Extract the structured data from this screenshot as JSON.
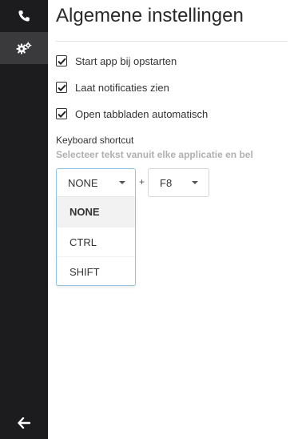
{
  "sidebar": {
    "items": [
      {
        "icon": "phone-icon"
      },
      {
        "icon": "gears-icon",
        "active": true
      },
      {
        "icon": "arrow-left-icon"
      }
    ]
  },
  "page": {
    "title": "Algemene instellingen"
  },
  "options": [
    {
      "label": "Start app bij opstarten",
      "checked": true
    },
    {
      "label": "Laat notificaties zien",
      "checked": true
    },
    {
      "label": "Open tabbladen automatisch",
      "checked": true
    }
  ],
  "shortcut": {
    "title": "Keyboard shortcut",
    "description": "Selecteer tekst vanuit elke applicatie en bel",
    "modifier_value": "NONE",
    "plus": "+",
    "key_value": "F8",
    "modifier_options": [
      "NONE",
      "CTRL",
      "SHIFT"
    ]
  },
  "colors": {
    "sidebar_bg": "#1c1c1e",
    "sidebar_active_bg": "#3a3a3d",
    "focus_border": "#8fc6e6",
    "muted_text": "#b0b0b0"
  }
}
